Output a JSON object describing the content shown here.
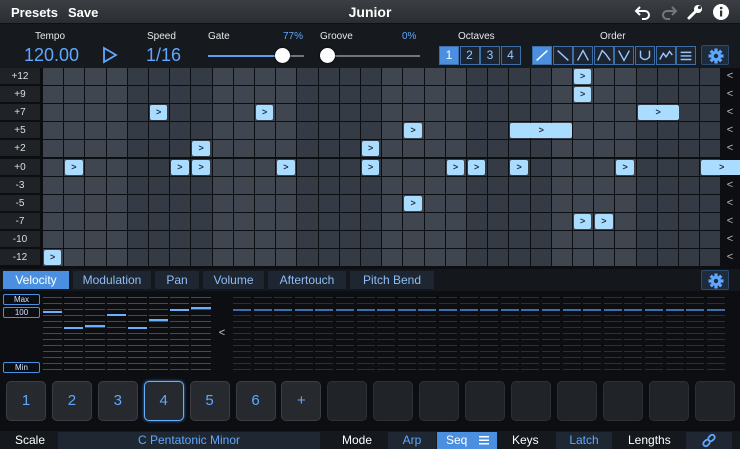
{
  "topbar": {
    "presets_label": "Presets",
    "save_label": "Save",
    "title": "Junior",
    "icons": [
      "undo-icon",
      "redo-icon",
      "wrench-icon",
      "info-icon"
    ]
  },
  "controls": {
    "tempo_label": "Tempo",
    "tempo_value": "120.00",
    "speed_label": "Speed",
    "speed_value": "1/16",
    "gate_label": "Gate",
    "gate_value": "77%",
    "gate_level": 0.77,
    "groove_label": "Groove",
    "groove_value": "0%",
    "groove_level": 0.0,
    "octaves_label": "Octaves",
    "octaves": [
      "1",
      "2",
      "3",
      "4"
    ],
    "octave_selected": "1",
    "order_label": "Order",
    "order_icons": [
      "order-up-icon",
      "order-down-icon",
      "order-up-down-icon",
      "order-up-down-inclusive-icon",
      "order-converge-icon",
      "order-diverge-icon",
      "order-random-icon",
      "order-as-played-icon"
    ],
    "order_selected": 0
  },
  "grid": {
    "rows": [
      "+12",
      "+9",
      "+7",
      "+5",
      "+2",
      "+0",
      "-3",
      "-5",
      "-7",
      "-10",
      "-12"
    ],
    "steps": 32,
    "note_symbol": ">",
    "row_arrow": "<",
    "notes": [
      {
        "row": 0,
        "step": 25,
        "len": 1
      },
      {
        "row": 1,
        "step": 25,
        "len": 1
      },
      {
        "row": 2,
        "step": 5,
        "len": 1
      },
      {
        "row": 2,
        "step": 10,
        "len": 1
      },
      {
        "row": 2,
        "step": 28,
        "len": 2
      },
      {
        "row": 3,
        "step": 17,
        "len": 1
      },
      {
        "row": 3,
        "step": 22,
        "len": 3
      },
      {
        "row": 4,
        "step": 7,
        "len": 1
      },
      {
        "row": 4,
        "step": 15,
        "len": 1
      },
      {
        "row": 5,
        "step": 1,
        "len": 1
      },
      {
        "row": 5,
        "step": 6,
        "len": 1
      },
      {
        "row": 5,
        "step": 7,
        "len": 1
      },
      {
        "row": 5,
        "step": 11,
        "len": 1
      },
      {
        "row": 5,
        "step": 15,
        "len": 1
      },
      {
        "row": 5,
        "step": 19,
        "len": 1
      },
      {
        "row": 5,
        "step": 20,
        "len": 1
      },
      {
        "row": 5,
        "step": 22,
        "len": 1
      },
      {
        "row": 5,
        "step": 27,
        "len": 1
      },
      {
        "row": 5,
        "step": 31,
        "len": 2
      },
      {
        "row": 7,
        "step": 17,
        "len": 1
      },
      {
        "row": 8,
        "step": 25,
        "len": 1
      },
      {
        "row": 8,
        "step": 26,
        "len": 1
      },
      {
        "row": 10,
        "step": 0,
        "len": 1
      }
    ]
  },
  "tabs": [
    "Velocity",
    "Modulation",
    "Pan",
    "Volume",
    "Aftertouch",
    "Pitch Bend"
  ],
  "tab_selected": 0,
  "velocity": {
    "max_label": "Max",
    "value_label": "100",
    "min_label": "Min",
    "collapse_symbol": "<",
    "active_levels": [
      0.78,
      0.58,
      0.6,
      0.74,
      0.58,
      0.68,
      0.8,
      0.82
    ]
  },
  "pads": {
    "labels": [
      "1",
      "2",
      "3",
      "4",
      "5",
      "6",
      "+"
    ],
    "selected": "4",
    "empty_count": 9
  },
  "bottom": {
    "scale_label": "Scale",
    "scale_value": "C Pentatonic Minor",
    "mode_label": "Mode",
    "arp_label": "Arp",
    "seq_label": "Seq",
    "keys_label": "Keys",
    "latch_label": "Latch",
    "lengths_label": "Lengths"
  },
  "colors": {
    "accent": "#4a8fe0",
    "value_blue": "#5fa8ff",
    "note_fill": "#a9dcff",
    "grid_cell": "#3f4650",
    "grid_cell_dark": "#353b44"
  }
}
